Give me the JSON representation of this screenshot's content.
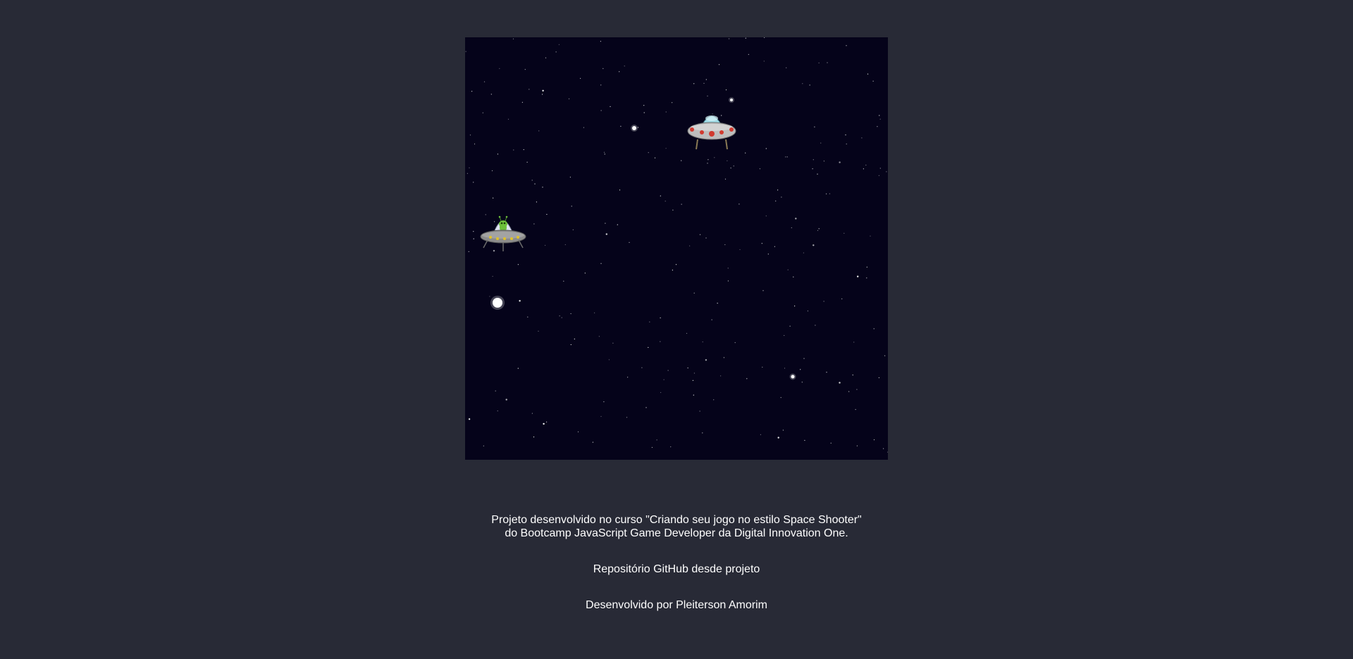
{
  "footer": {
    "credits_line1": "Projeto desenvolvido no curso \"Criando seu jogo no estilo Space Shooter\"",
    "credits_line2": "do Bootcamp JavaScript Game Developer da Digital Innovation One.",
    "repo_link": "Repositório GitHub desde projeto",
    "author": "Desenvolvido por Pleiterson Amorim"
  },
  "colors": {
    "page_background": "#282a36",
    "game_background": "#05031a",
    "text": "#ffffff"
  },
  "game": {
    "sprites": [
      "player-ufo-alien-icon",
      "enemy-ufo-icon",
      "projectile-icon"
    ]
  }
}
